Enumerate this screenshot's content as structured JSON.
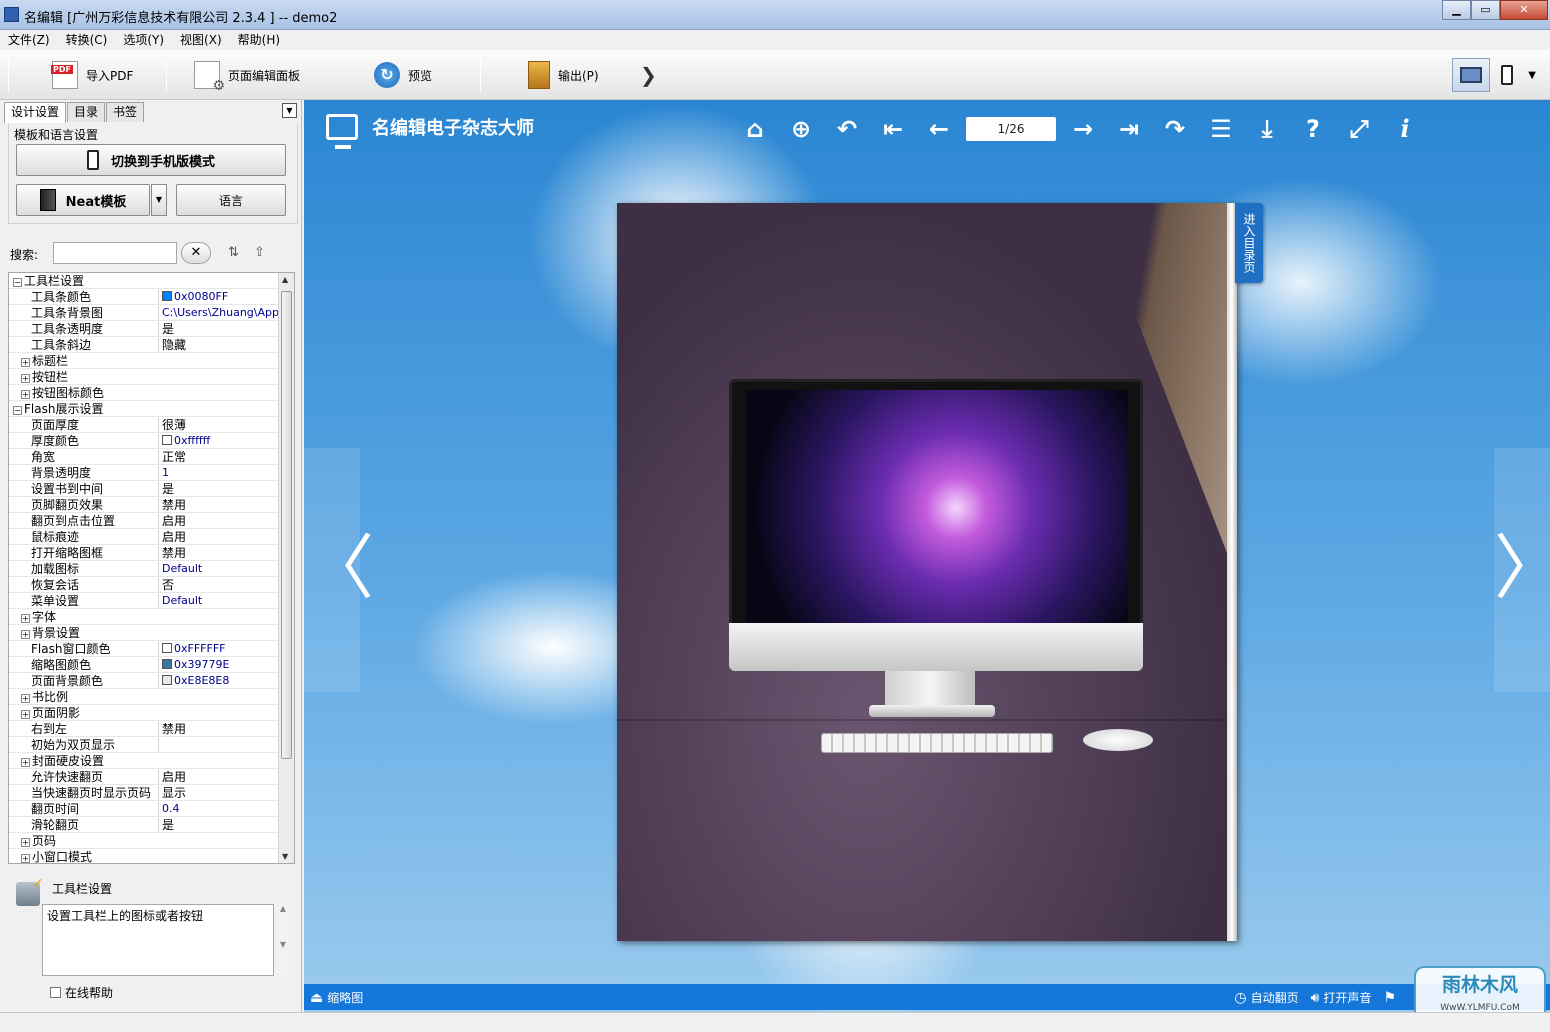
{
  "window": {
    "title": "名编辑 [广州万彩信息技术有限公司 2.3.4 ] -- demo2",
    "min": "▁",
    "max": "▭",
    "close": "✕"
  },
  "menu": [
    "文件(Z)",
    "转换(C)",
    "选项(Y)",
    "视图(X)",
    "帮助(H)"
  ],
  "toolbar": {
    "import_pdf": "导入PDF",
    "page_editor": "页面编辑面板",
    "preview": "预览",
    "output": "输出(P)",
    "more": "❯",
    "device_dropdown": "▼"
  },
  "left": {
    "tabs": [
      "设计设置",
      "目录",
      "书签"
    ],
    "panel_dropdown": "▼",
    "group_label": "模板和语言设置",
    "switch_mobile": "切换到手机版模式",
    "template": "Neat模板",
    "template_dd": "▼",
    "language": "语言",
    "search_label": "搜索:",
    "search_value": "",
    "search_clear": "✕",
    "sort_asc": "⇅",
    "sort_desc": "⇧"
  },
  "props": [
    {
      "t": "g",
      "exp": "⊟",
      "k": "工具栏设置"
    },
    {
      "t": "p",
      "k": "工具条颜色",
      "sw": "#0080ff",
      "v": "0x0080FF"
    },
    {
      "t": "p",
      "k": "工具条背景图",
      "v": "C:\\Users\\Zhuang\\App..."
    },
    {
      "t": "p",
      "k": "工具条透明度",
      "v": "是",
      "zh": true
    },
    {
      "t": "p",
      "k": "工具条斜边",
      "v": "隐藏",
      "zh": true
    },
    {
      "t": "g2",
      "exp": "⊞",
      "k": "标题栏"
    },
    {
      "t": "g2",
      "exp": "⊞",
      "k": "按钮栏"
    },
    {
      "t": "g2",
      "exp": "⊞",
      "k": "按钮图标颜色"
    },
    {
      "t": "g",
      "exp": "⊟",
      "k": "Flash展示设置"
    },
    {
      "t": "p",
      "k": "页面厚度",
      "v": "很薄",
      "zh": true
    },
    {
      "t": "p",
      "k": "厚度颜色",
      "sw": "#ffffff",
      "v": "0xffffff"
    },
    {
      "t": "p",
      "k": "角宽",
      "v": "正常",
      "zh": true
    },
    {
      "t": "p",
      "k": "背景透明度",
      "v": "1"
    },
    {
      "t": "p",
      "k": "设置书到中间",
      "v": "是",
      "zh": true
    },
    {
      "t": "p",
      "k": "页脚翻页效果",
      "v": " 禁用",
      "zh": true
    },
    {
      "t": "p",
      "k": "翻页到点击位置",
      "v": "启用",
      "zh": true
    },
    {
      "t": "p",
      "k": "鼠标痕迹",
      "v": "启用",
      "zh": true
    },
    {
      "t": "p",
      "k": "打开缩略图框",
      "v": "禁用",
      "zh": true
    },
    {
      "t": "p",
      "k": "加载图标",
      "v": "Default"
    },
    {
      "t": "p",
      "k": "恢复会话",
      "v": " 否",
      "zh": true
    },
    {
      "t": "p",
      "k": "菜单设置",
      "v": "Default"
    },
    {
      "t": "g2",
      "exp": "⊞",
      "k": "字体"
    },
    {
      "t": "g2",
      "exp": "⊞",
      "k": "背景设置"
    },
    {
      "t": "p",
      "k": "Flash窗口颜色",
      "sw": "#ffffff",
      "v": "0xFFFFFF"
    },
    {
      "t": "p",
      "k": "缩略图颜色",
      "sw": "#39779e",
      "v": "0x39779E"
    },
    {
      "t": "p",
      "k": "页面背景颜色",
      "sw": "#e8e8e8",
      "v": "0xE8E8E8"
    },
    {
      "t": "g2",
      "exp": "⊞",
      "k": "书比例"
    },
    {
      "t": "g2",
      "exp": "⊞",
      "k": "页面阴影"
    },
    {
      "t": "p",
      "k": "右到左",
      "v": "禁用",
      "zh": true
    },
    {
      "t": "p",
      "k": "初始为双页显示",
      "v": ""
    },
    {
      "t": "g2",
      "exp": "⊞",
      "k": "封面硬皮设置"
    },
    {
      "t": "p",
      "k": "允许快速翻页",
      "v": "启用",
      "zh": true
    },
    {
      "t": "p",
      "k": "当快速翻页时显示页码",
      "v": "显示",
      "zh": true
    },
    {
      "t": "p",
      "k": "翻页时间",
      "v": "0.4"
    },
    {
      "t": "p",
      "k": "滑轮翻页",
      "v": "是",
      "zh": true
    },
    {
      "t": "g2",
      "exp": "⊞",
      "k": "页码"
    },
    {
      "t": "g2",
      "exp": "⊞",
      "k": "小窗口模式"
    }
  ],
  "help": {
    "title": "工具栏设置",
    "text": "设置工具栏上的图标或者按钮",
    "online_help": "在线帮助"
  },
  "viewer": {
    "logo": "名编辑电子杂志大师",
    "page_indicator": "1/26",
    "toc_tab": "进入目录页",
    "nav_icons": {
      "home": "⌂",
      "zoom": "⊕",
      "back": "↶",
      "first": "⇤",
      "prev": "←",
      "next": "→",
      "last": "⇥",
      "forward": "↷",
      "list": "☰",
      "download": "⤓",
      "help": "?",
      "fullscreen": "⤢",
      "info": "i"
    },
    "left_arrow": "〈",
    "right_arrow": "〉",
    "thumbnails": "缩略图",
    "auto_flip": "自动翻页",
    "sound": "打开声音",
    "watermark_main": "雨林木风",
    "watermark_sub": "WwW.YLMFU.CoM"
  },
  "colors": {
    "toolbar_blue": "#1477d9",
    "sky": "#2a86d2"
  }
}
